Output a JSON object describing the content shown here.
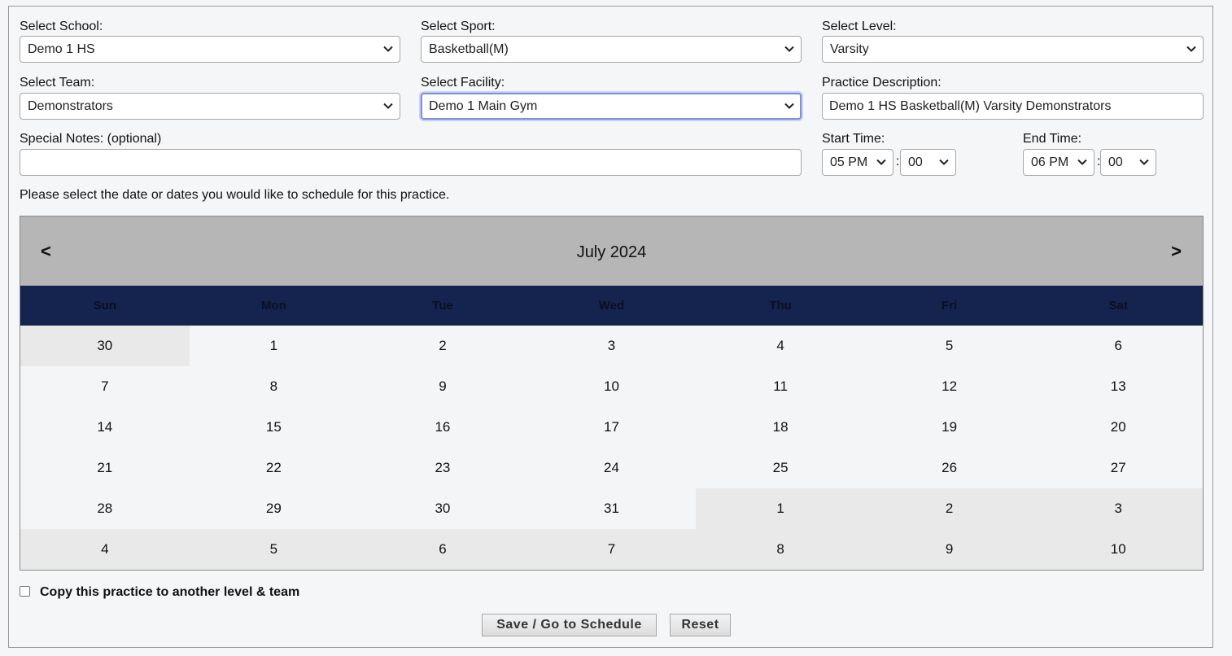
{
  "form": {
    "school": {
      "label": "Select School:",
      "value": "Demo 1 HS"
    },
    "sport": {
      "label": "Select Sport:",
      "value": "Basketball(M)"
    },
    "level": {
      "label": "Select Level:",
      "value": "Varsity"
    },
    "team": {
      "label": "Select Team:",
      "value": "Demonstrators"
    },
    "facility": {
      "label": "Select Facility:",
      "value": "Demo 1 Main Gym"
    },
    "description": {
      "label": "Practice Description:",
      "value": "Demo 1 HS Basketball(M) Varsity Demonstrators"
    },
    "notes": {
      "label": "Special Notes: (optional)",
      "value": ""
    },
    "start": {
      "label": "Start Time:",
      "hour": "05 PM",
      "minute": "00"
    },
    "end": {
      "label": "End Time:",
      "hour": "06 PM",
      "minute": "00"
    },
    "colon": ":"
  },
  "instructions": "Please select the date or dates you would like to schedule for this practice.",
  "calendar": {
    "title": "July 2024",
    "prev": "<",
    "next": ">",
    "weekdays": [
      "Sun",
      "Mon",
      "Tue",
      "Wed",
      "Thu",
      "Fri",
      "Sat"
    ],
    "weeks": [
      [
        {
          "d": "30",
          "other": true
        },
        {
          "d": "1"
        },
        {
          "d": "2"
        },
        {
          "d": "3"
        },
        {
          "d": "4"
        },
        {
          "d": "5"
        },
        {
          "d": "6"
        }
      ],
      [
        {
          "d": "7"
        },
        {
          "d": "8"
        },
        {
          "d": "9"
        },
        {
          "d": "10"
        },
        {
          "d": "11"
        },
        {
          "d": "12"
        },
        {
          "d": "13"
        }
      ],
      [
        {
          "d": "14"
        },
        {
          "d": "15"
        },
        {
          "d": "16"
        },
        {
          "d": "17"
        },
        {
          "d": "18"
        },
        {
          "d": "19"
        },
        {
          "d": "20"
        }
      ],
      [
        {
          "d": "21"
        },
        {
          "d": "22"
        },
        {
          "d": "23"
        },
        {
          "d": "24"
        },
        {
          "d": "25"
        },
        {
          "d": "26"
        },
        {
          "d": "27"
        }
      ],
      [
        {
          "d": "28"
        },
        {
          "d": "29"
        },
        {
          "d": "30"
        },
        {
          "d": "31"
        },
        {
          "d": "1",
          "other": true
        },
        {
          "d": "2",
          "other": true
        },
        {
          "d": "3",
          "other": true
        }
      ],
      [
        {
          "d": "4",
          "other": true
        },
        {
          "d": "5",
          "other": true
        },
        {
          "d": "6",
          "other": true
        },
        {
          "d": "7",
          "other": true
        },
        {
          "d": "8",
          "other": true
        },
        {
          "d": "9",
          "other": true
        },
        {
          "d": "10",
          "other": true
        }
      ]
    ]
  },
  "copy_label": "Copy this practice to another level & team",
  "buttons": {
    "save": "Save / Go to Schedule",
    "reset": "Reset"
  },
  "colors": {
    "header_band": "#b6b6b6",
    "weekday_band": "#15244f",
    "other_month": "#e9e9e9"
  }
}
